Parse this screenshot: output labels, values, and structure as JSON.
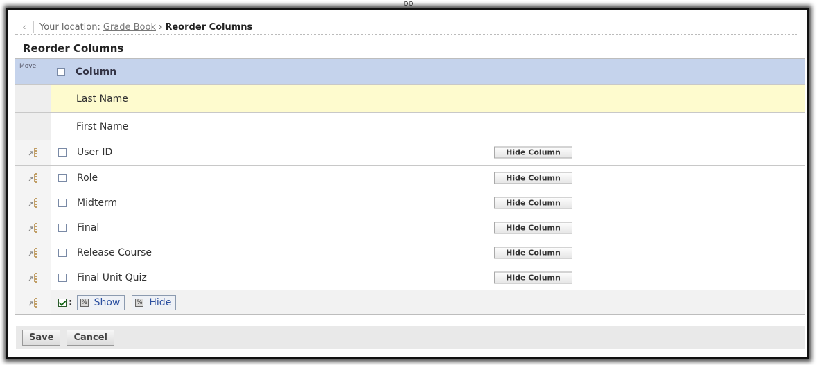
{
  "window": {
    "top_caption": "pp"
  },
  "breadcrumb": {
    "back_label": "‹",
    "prefix": "Your location:",
    "link": "Grade Book",
    "separator": "›",
    "current": "Reorder Columns"
  },
  "page": {
    "title": "Reorder Columns"
  },
  "table": {
    "header": {
      "move": "Move",
      "column": "Column"
    },
    "fixed_rows": [
      {
        "label": "Last Name",
        "highlighted": true
      },
      {
        "label": "First Name",
        "highlighted": false
      }
    ],
    "rows": [
      {
        "label": "User ID",
        "action": "Hide Column"
      },
      {
        "label": "Role",
        "action": "Hide Column"
      },
      {
        "label": "Midterm",
        "action": "Hide Column"
      },
      {
        "label": "Final",
        "action": "Hide Column"
      },
      {
        "label": "Release Course",
        "action": "Hide Column"
      },
      {
        "label": "Final Unit Quiz",
        "action": "Hide Column"
      }
    ],
    "bulk_actions": {
      "colon": ":",
      "show": "Show",
      "hide": "Hide"
    }
  },
  "footer": {
    "save": "Save",
    "cancel": "Cancel"
  },
  "colors": {
    "header_bg": "#c5d3ec",
    "highlight_row": "#fefbce",
    "link": "#2b4fa0"
  },
  "icons": {
    "back": "chevron-left-icon",
    "move": "drag-handle-icon",
    "show": "show-icon",
    "hide": "hide-icon"
  }
}
